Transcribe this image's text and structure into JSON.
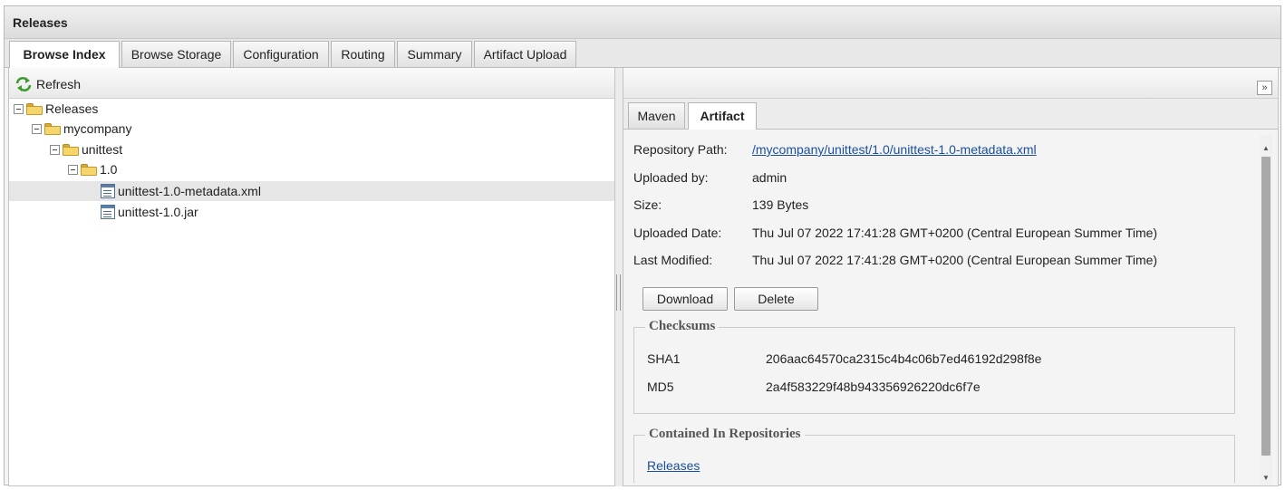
{
  "panel": {
    "title": "Releases"
  },
  "tabs": [
    {
      "label": "Browse Index",
      "active": true
    },
    {
      "label": "Browse Storage",
      "active": false
    },
    {
      "label": "Configuration",
      "active": false
    },
    {
      "label": "Routing",
      "active": false
    },
    {
      "label": "Summary",
      "active": false
    },
    {
      "label": "Artifact Upload",
      "active": false
    }
  ],
  "toolbar": {
    "refresh_label": "Refresh"
  },
  "tree": {
    "nodes": [
      {
        "label": "Releases",
        "type": "folder",
        "expanded": true
      },
      {
        "label": "mycompany",
        "type": "folder",
        "expanded": true
      },
      {
        "label": "unittest",
        "type": "folder",
        "expanded": true
      },
      {
        "label": "1.0",
        "type": "folder",
        "expanded": true
      },
      {
        "label": "unittest-1.0-metadata.xml",
        "type": "file",
        "selected": true
      },
      {
        "label": "unittest-1.0.jar",
        "type": "file",
        "selected": false
      }
    ]
  },
  "right": {
    "collapse_glyph": "»",
    "subtabs": [
      {
        "label": "Maven",
        "active": false
      },
      {
        "label": "Artifact",
        "active": true
      }
    ],
    "fields": {
      "repo_path_label": "Repository Path:",
      "repo_path_value": "/mycompany/unittest/1.0/unittest-1.0-metadata.xml",
      "uploaded_by_label": "Uploaded by:",
      "uploaded_by_value": "admin",
      "size_label": "Size:",
      "size_value": "139 Bytes",
      "uploaded_date_label": "Uploaded Date:",
      "uploaded_date_value": "Thu Jul 07 2022 17:41:28 GMT+0200 (Central European Summer Time)",
      "last_modified_label": "Last Modified:",
      "last_modified_value": "Thu Jul 07 2022 17:41:28 GMT+0200 (Central European Summer Time)"
    },
    "buttons": {
      "download": "Download",
      "delete": "Delete"
    },
    "checksums": {
      "legend": "Checksums",
      "sha1_label": "SHA1",
      "sha1_value": "206aac64570ca2315c4b4c06b7ed46192d298f8e",
      "md5_label": "MD5",
      "md5_value": "2a4f583229f48b943356926220dc6f7e"
    },
    "contained": {
      "legend": "Contained In Repositories",
      "repo_link": "Releases"
    }
  },
  "icons": {
    "refresh": "refresh-icon",
    "folder": "folder-icon",
    "file": "file-icon",
    "toggle": "collapse-toggle-icon"
  },
  "colors": {
    "link": "#1a4f9c",
    "folder": "#f6d56b",
    "selection": "#e6e6e6"
  }
}
